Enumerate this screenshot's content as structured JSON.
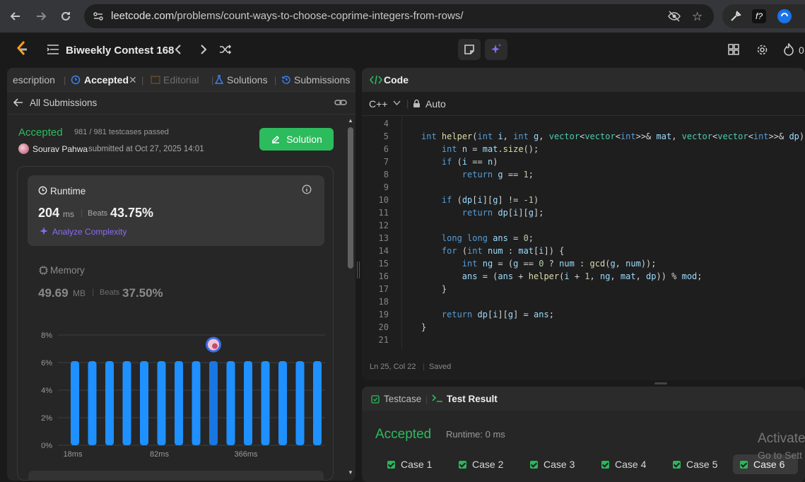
{
  "browser": {
    "url_host": "leetcode.com",
    "url_path": "/problems/count-ways-to-choose-coprime-integers-from-rows/"
  },
  "header": {
    "contest_title": "Biweekly Contest 168",
    "streak_count": "0"
  },
  "left_tabs": [
    {
      "label": "escription"
    },
    {
      "label": "Accepted"
    },
    {
      "label": "Editorial"
    },
    {
      "label": "Solutions"
    },
    {
      "label": "Submissions"
    }
  ],
  "submissions": {
    "back_label": "All Submissions",
    "status": "Accepted",
    "testcases": "981 / 981 testcases passed",
    "author": "Sourav Pahwa",
    "submitted_at": "submitted at Oct 27, 2025 14:01",
    "solution_button": "Solution"
  },
  "runtime": {
    "label": "Runtime",
    "value": "204",
    "unit": "ms",
    "beats_label": "Beats",
    "beats_value": "43.75%",
    "analyze_label": "Analyze Complexity"
  },
  "memory": {
    "label": "Memory",
    "value": "49.69",
    "unit": "MB",
    "beats_label": "Beats",
    "beats_value": "37.50%"
  },
  "chart_data": {
    "type": "bar",
    "y_ticks": [
      "8%",
      "6%",
      "4%",
      "2%",
      "0%"
    ],
    "ylim": [
      0,
      8
    ],
    "x_tick_labels": [
      "18ms",
      "82ms",
      "366ms"
    ],
    "values": [
      6.1,
      6.1,
      6.1,
      6.1,
      6.1,
      6.1,
      6.1,
      6.1,
      6.1,
      6.1,
      6.1,
      6.1,
      6.1,
      6.1,
      6.1
    ],
    "highlight_index": 8,
    "bar_color": "#1e90ff",
    "grid": true
  },
  "code_panel": {
    "title": "Code",
    "language": "C++",
    "mode": "Auto",
    "status_position": "Ln 25, Col 22",
    "status_saved": "Saved",
    "lines": [
      {
        "n": "4",
        "t": ""
      },
      {
        "n": "5",
        "t": "int helper(int i, int g, vector<vector<int>>& mat, vector<vector<int>>& dp) {"
      },
      {
        "n": "6",
        "t": "    int n = mat.size();"
      },
      {
        "n": "7",
        "t": "    if (i == n)"
      },
      {
        "n": "8",
        "t": "        return g == 1;"
      },
      {
        "n": "9",
        "t": ""
      },
      {
        "n": "10",
        "t": "    if (dp[i][g] != -1)"
      },
      {
        "n": "11",
        "t": "        return dp[i][g];"
      },
      {
        "n": "12",
        "t": ""
      },
      {
        "n": "13",
        "t": "    long long ans = 0;"
      },
      {
        "n": "14",
        "t": "    for (int num : mat[i]) {"
      },
      {
        "n": "15",
        "t": "        int ng = (g == 0 ? num : gcd(g, num));"
      },
      {
        "n": "16",
        "t": "        ans = (ans + helper(i + 1, ng, mat, dp)) % mod;"
      },
      {
        "n": "17",
        "t": "    }"
      },
      {
        "n": "18",
        "t": ""
      },
      {
        "n": "19",
        "t": "    return dp[i][g] = ans;"
      },
      {
        "n": "20",
        "t": "}"
      },
      {
        "n": "21",
        "t": ""
      }
    ]
  },
  "result_panel": {
    "testcase_tab": "Testcase",
    "result_tab": "Test Result",
    "status": "Accepted",
    "runtime": "Runtime: 0 ms",
    "cases": [
      "Case 1",
      "Case 2",
      "Case 3",
      "Case 4",
      "Case 5",
      "Case 6"
    ],
    "watermark_line1": "Activate",
    "watermark_line2": "Go to Sett"
  }
}
